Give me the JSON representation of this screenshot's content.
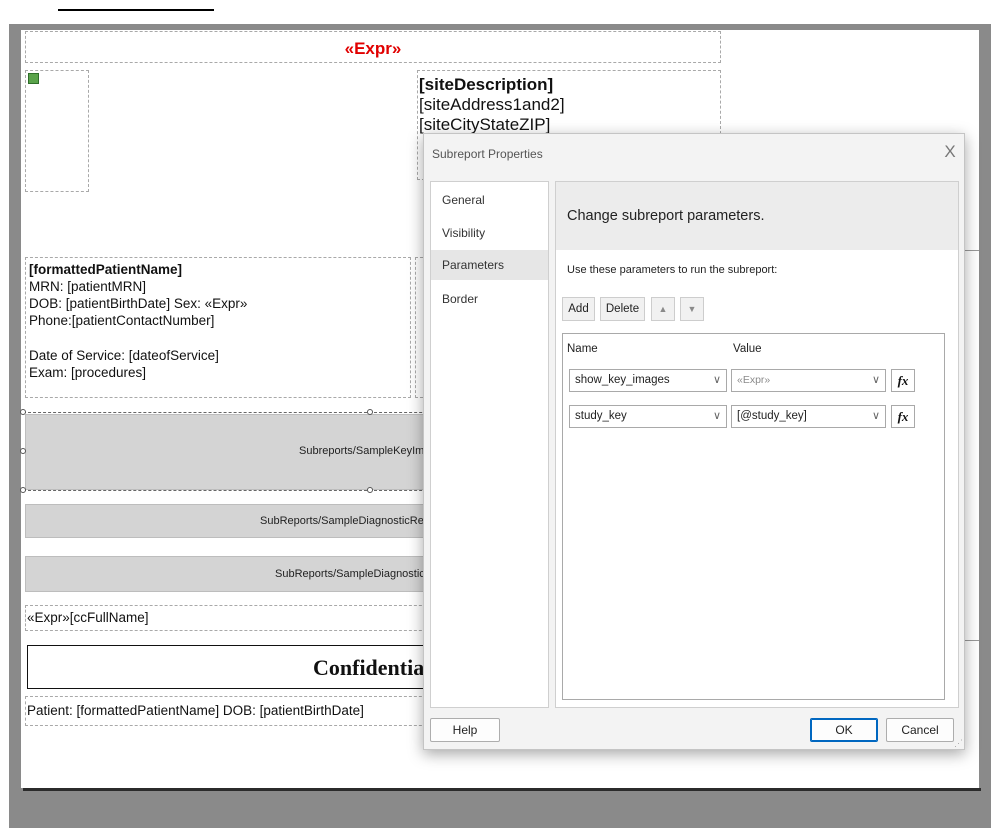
{
  "report": {
    "title_expr": "«Expr»",
    "site": {
      "description": "[siteDescription]",
      "address": "[siteAddress1and2]",
      "city_state_zip": "[siteCityStateZIP]"
    },
    "patient": {
      "name": "[formattedPatientName]",
      "mrn": "MRN: [patientMRN]",
      "dob_sex": "DOB: [patientBirthDate]    Sex: «Expr»",
      "phone": "Phone:[patientContactNumber]",
      "date_of_service": "Date of Service: [dateofService]",
      "exam": "Exam:  [procedures]"
    },
    "subreports": {
      "key_images": "Subreports/SampleKeyIma",
      "diagnostic_1": "SubReports/SampleDiagnosticRep",
      "diagnostic_2": "SubReports/SampleDiagnosticR"
    },
    "cc_line": "«Expr»[ccFullName]",
    "confidential": "Confidentia",
    "footer": "Patient: [formattedPatientName]   DOB: [patientBirthDate]"
  },
  "dialog": {
    "title": "Subreport Properties",
    "close": "X",
    "nav": [
      {
        "label": "General"
      },
      {
        "label": "Visibility"
      },
      {
        "label": "Parameters"
      },
      {
        "label": "Border"
      }
    ],
    "selected_nav": "Parameters",
    "header": "Change subreport parameters.",
    "description": "Use these parameters to run the subreport:",
    "toolbar": {
      "add": "Add",
      "delete": "Delete",
      "up": "▲",
      "down": "▼"
    },
    "columns": {
      "name": "Name",
      "value": "Value"
    },
    "parameters": [
      {
        "name": "show_key_images",
        "value": "«Expr»"
      },
      {
        "name": "study_key",
        "value": "[@study_key]"
      }
    ],
    "fx_label": "fx",
    "buttons": {
      "help": "Help",
      "ok": "OK",
      "cancel": "Cancel"
    }
  }
}
